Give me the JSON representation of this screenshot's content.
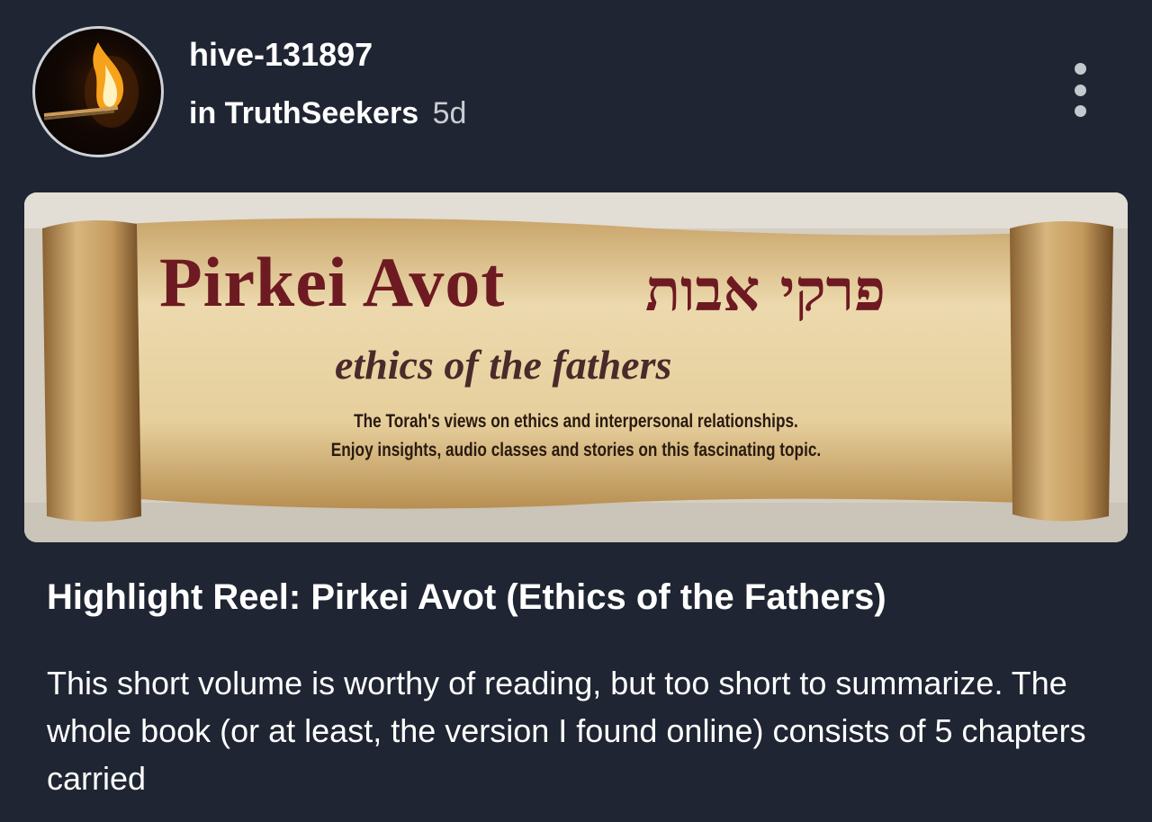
{
  "post": {
    "author": "hive-131897",
    "in_label": "in",
    "community": "TruthSeekers",
    "age": "5d",
    "title": "Highlight Reel: Pirkei Avot (Ethics of the Fathers)",
    "body": "This short volume is worthy of reading, but too short to summarize. The whole book (or at least, the version I found online) consists of 5 chapters carried"
  },
  "banner": {
    "title": "Pirkei Avot",
    "hebrew": "פרקי אבות",
    "subtitle": "ethics of the fathers",
    "line1": "The Torah's views on ethics and interpersonal relationships.",
    "line2": "Enjoy insights, audio classes and stories on this fascinating topic."
  },
  "icons": {
    "more": "more-vertical-icon"
  },
  "colors": {
    "background": "#1f2532",
    "banner_text": "#6e1a22",
    "parchment": "#d9bf8a"
  }
}
